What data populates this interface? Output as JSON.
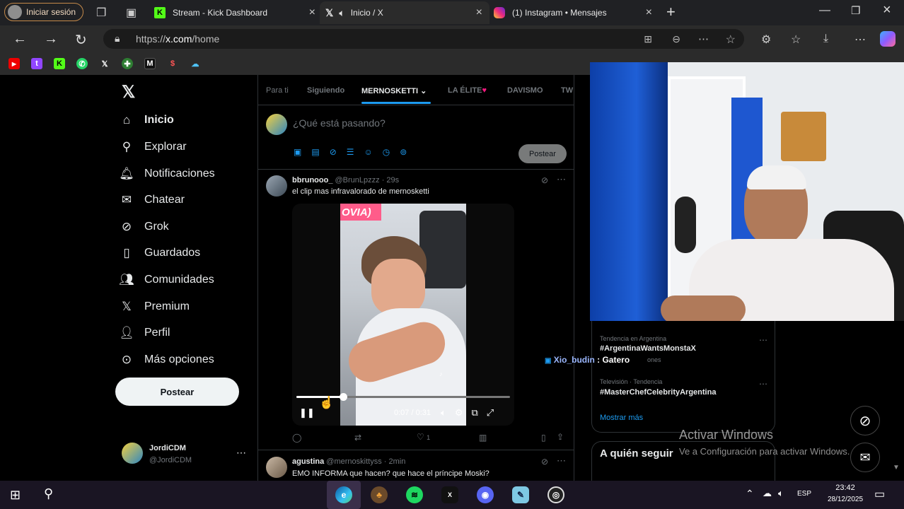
{
  "browser": {
    "signin_label": "Iniciar sesión",
    "tabs": [
      {
        "title": "Stream - Kick Dashboard"
      },
      {
        "title": "Inicio / X"
      },
      {
        "title": "(1) Instagram • Mensajes"
      }
    ],
    "url_prefix": "https://",
    "url_host": "x.com",
    "url_path": "/home"
  },
  "sidebar": {
    "items": [
      {
        "label": "Inicio",
        "icon": "home-icon"
      },
      {
        "label": "Explorar",
        "icon": "search-icon"
      },
      {
        "label": "Notificaciones",
        "icon": "bell-icon"
      },
      {
        "label": "Chatear",
        "icon": "mail-icon"
      },
      {
        "label": "Grok",
        "icon": "grok-icon"
      },
      {
        "label": "Guardados",
        "icon": "bookmark-icon"
      },
      {
        "label": "Comunidades",
        "icon": "people-icon"
      },
      {
        "label": "Premium",
        "icon": "x-icon"
      },
      {
        "label": "Perfil",
        "icon": "person-icon"
      },
      {
        "label": "Más opciones",
        "icon": "more-circle-icon"
      }
    ],
    "post_label": "Postear",
    "account_name": "JordiCDM",
    "account_handle": "@JordiCDM"
  },
  "feed": {
    "tabs": [
      "Para ti",
      "Siguiendo",
      "MERNOSKETTI",
      "LA ÉLITE",
      "DAVISMO",
      "TW"
    ],
    "active_tab": "MERNOSKETTI",
    "composer_placeholder": "¿Qué está pasando?",
    "composer_post_label": "Postear",
    "post1": {
      "name": "bbrunooo_",
      "handle_time": "@BrunLpzzz · 29s",
      "text": "el clip mas infravalorado de mernosketti",
      "video_caption": "OVIA)",
      "video_time": "0:07 / 0:31",
      "progress": 0.22,
      "likes": "1"
    },
    "post2": {
      "name": "agustina",
      "handle_time": "@mernoskittyss · 2min",
      "text": "EMO INFORMA que hacen? que hace el príncipe Moski?"
    }
  },
  "trends": [
    {
      "context": "Tendencia en Argentina",
      "name": "#ArgentinaWantsMonstaX",
      "sub": "ones"
    },
    {
      "context": "Televisión · Tendencia",
      "name": "#MasterChefCelebrityArgentina"
    }
  ],
  "trends_more": "Mostrar más",
  "who_to_follow": "A quién seguir",
  "chat_overlay": {
    "user": "Xio_budin",
    "message": ": Gatero"
  },
  "watermark": {
    "title": "Activar Windows",
    "subtitle": "Ve a Configuración para activar Windows."
  },
  "taskbar": {
    "lang": "ESP",
    "time": "23:42",
    "date": "28/12/2025"
  }
}
